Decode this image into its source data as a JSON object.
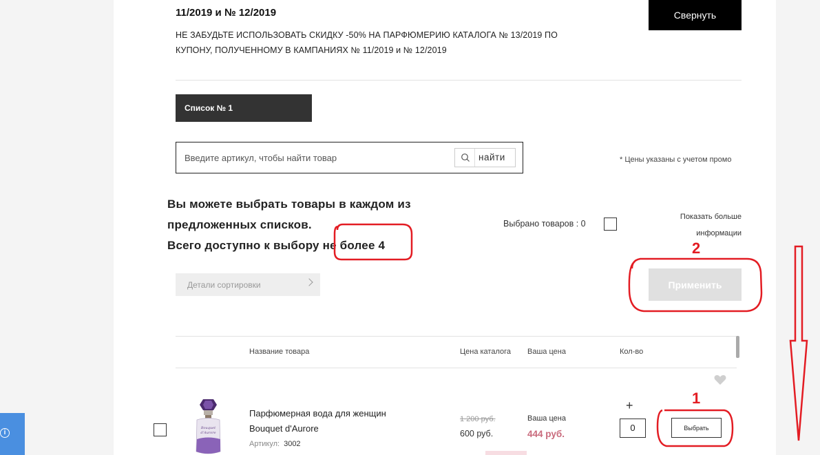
{
  "promo": {
    "title": "11/2019 и № 12/2019",
    "text": "НЕ ЗАБУДЬТЕ ИСПОЛЬЗОВАТЬ СКИДКУ -50% НА ПАРФЮМЕРИЮ КАТАЛОГА № 13/2019 ПО КУПОНУ, ПОЛУЧЕННОМУ В КАМПАНИЯХ № 11/2019 и № 12/2019",
    "collapse_label": "Свернуть"
  },
  "list_tab": {
    "label": "Список № 1"
  },
  "search": {
    "placeholder": "Введите артикул, чтобы найти товар",
    "button_label": "найти"
  },
  "price_note": "* Цены указаны с учетом промо",
  "info": {
    "line1": "Вы можете выбрать товары в каждом из",
    "line2": "предложенных списков.",
    "line3_prefix": "Всего доступно к выбору",
    "line3_highlight": " не более 4"
  },
  "selected": {
    "label": "Выбрано товаров : 0"
  },
  "more_info": {
    "line1": "Показать больше",
    "line2": "информации"
  },
  "sort": {
    "label": "Детали сортировки"
  },
  "apply": {
    "label": "Применить"
  },
  "table": {
    "headers": {
      "name": "Название товара",
      "catalog_price": "Цена каталога",
      "your_price": "Ваша цена",
      "qty": "Кол-во"
    }
  },
  "product": {
    "name_line1": "Парфюмерная вода для женщин",
    "name_line2": "Bouquet d'Aurore",
    "sku_label": "Артикул:",
    "sku": "3002",
    "old_price": "1 200 руб.",
    "catalog_price": "600 руб.",
    "your_price_label": "Ваша цена",
    "your_price": "444 руб.",
    "qty": "0",
    "plus": "+",
    "choose_label": "Выбрать",
    "image_text_line1": "Bouquet",
    "image_text_line2": "d'Aurore"
  },
  "chat": {
    "icon_glyph": "i"
  },
  "annotations": {
    "num1": "1",
    "num2": "2",
    "color": "#e31c23"
  }
}
